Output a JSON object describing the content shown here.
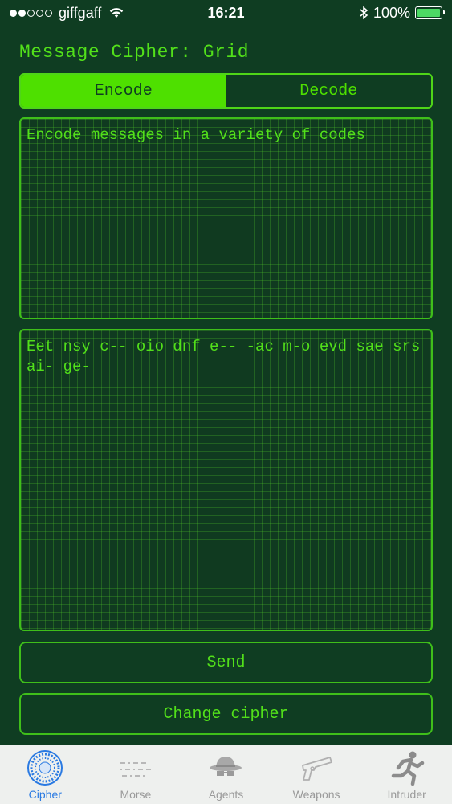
{
  "status_bar": {
    "carrier": "giffgaff",
    "time": "16:21",
    "battery": "100%",
    "signal_filled": 2,
    "signal_total": 5
  },
  "title": "Message Cipher: Grid",
  "mode_tabs": {
    "encode": "Encode",
    "decode": "Decode",
    "selected": "encode"
  },
  "input_text": "Encode messages in a variety of codes",
  "output_text": "Eet nsy c-- oio dnf e-- -ac m-o evd sae srs ai- ge-",
  "buttons": {
    "send": "Send",
    "change_cipher": "Change cipher"
  },
  "tab_bar": {
    "items": [
      {
        "label": "Cipher",
        "icon": "cipher-wheel-icon",
        "active": true
      },
      {
        "label": "Morse",
        "icon": "morse-icon",
        "active": false
      },
      {
        "label": "Agents",
        "icon": "spy-agent-icon",
        "active": false
      },
      {
        "label": "Weapons",
        "icon": "pistol-icon",
        "active": false
      },
      {
        "label": "Intruder",
        "icon": "running-man-icon",
        "active": false
      }
    ]
  },
  "colors": {
    "background": "#0f3d22",
    "accent_green": "#4ee000",
    "active_tab_blue": "#2a7ae2"
  }
}
